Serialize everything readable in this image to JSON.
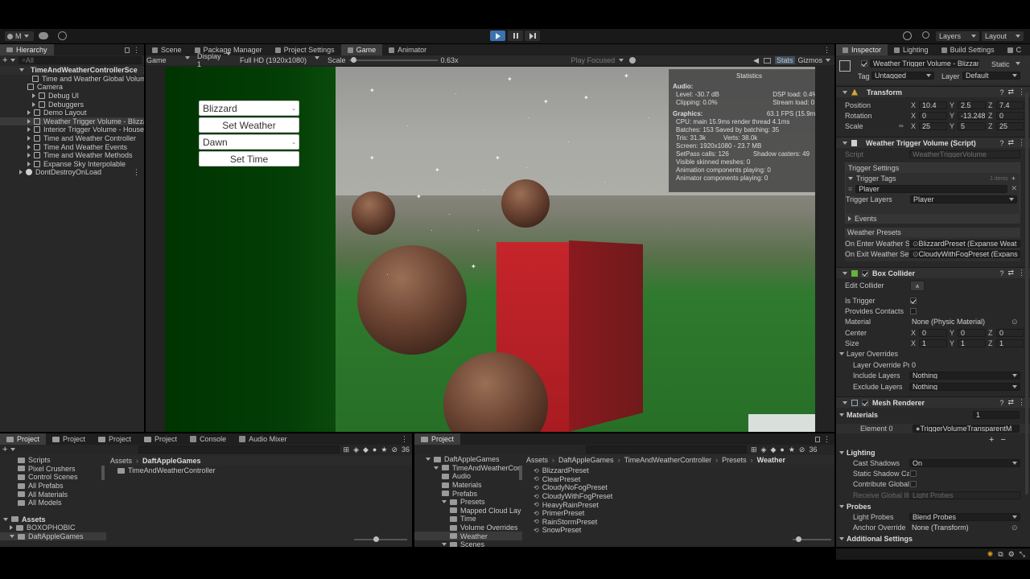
{
  "toolbar": {
    "account": "M",
    "layers": "Layers",
    "layout": "Layout"
  },
  "hierarchy": {
    "tab": "Hierarchy",
    "search_placeholder": "All",
    "root": "TimeAndWeatherControllerSce",
    "items": [
      "Time and Weather Global Volume",
      "Camera",
      "Debug UI",
      "Debuggers",
      "Demo Layout",
      "Weather Trigger Volume - Blizzar",
      "Interior Trigger Volume - House",
      "Time and Weather Controller",
      "Time And Weather Events",
      "Time and Weather Methods",
      "Expanse Sky Interpolable"
    ],
    "ddol": "DontDestroyOnLoad"
  },
  "center_tabs": [
    "Scene",
    "Package Manager",
    "Project Settings",
    "Game",
    "Animator"
  ],
  "game_bar": {
    "mode": "Game",
    "display": "Display 1",
    "resolution": "Full HD (1920x1080)",
    "scale_label": "Scale",
    "scale_value": "0.63x",
    "play_focused": "Play Focused",
    "stats": "Stats",
    "gizmos": "Gizmos"
  },
  "game_ui": {
    "weather_value": "Blizzard",
    "set_weather": "Set Weather",
    "time_value": "Dawn",
    "set_time": "Set Time"
  },
  "stats": {
    "title": "Statistics",
    "audio_hdr": "Audio:",
    "level": "Level: -30.7 dB",
    "clipping": "Clipping: 0.0%",
    "dsp": "DSP load: 0.4%",
    "stream": "Stream load: 0.0%",
    "graphics_hdr": "Graphics:",
    "fps": "63.1 FPS (15.9ms)",
    "cpu": "CPU: main 15.9ms  render thread 4.1ms",
    "batches": "Batches: 153    Saved by batching: 35",
    "tris": "Tris: 31.3k",
    "verts": "Verts: 38.0k",
    "screen": "Screen: 1920x1080 - 23.7 MB",
    "setpass": "SetPass calls: 126",
    "shadow": "Shadow casters: 49",
    "skinned": "Visible skinned meshes: 0",
    "anim": "Animation components playing: 0",
    "animator": "Animator components playing: 0"
  },
  "inspector_tabs": [
    "Inspector",
    "Lighting",
    "Build Settings",
    "C"
  ],
  "inspector": {
    "object_name": "Weather Trigger Volume - Blizzar",
    "static": "Static",
    "tag_label": "Tag",
    "tag_value": "Untagged",
    "layer_label": "Layer",
    "layer_value": "Default",
    "transform": {
      "title": "Transform",
      "position_label": "Position",
      "position": [
        "10.4",
        "2.5",
        "7.4"
      ],
      "rotation_label": "Rotation",
      "rotation": [
        "0",
        "-13.248",
        "0"
      ],
      "scale_label": "Scale",
      "scale": [
        "25",
        "5",
        "25"
      ]
    },
    "script_comp": {
      "title": "Weather Trigger Volume (Script)",
      "script_label": "Script",
      "script_value": "WeatherTriggerVolume",
      "trigger_settings": "Trigger Settings",
      "trigger_tags": "Trigger Tags",
      "items_count": "1 items",
      "tag_item": "Player",
      "trigger_layers_label": "Trigger Layers",
      "trigger_layers_value": "Player",
      "events": "Events",
      "weather_presets": "Weather Presets",
      "on_enter_label": "On Enter Weather Se",
      "on_enter_value": "BlizzardPreset (Expanse Weat",
      "on_exit_label": "On Exit Weather Sett",
      "on_exit_value": "CloudyWithFogPreset (Expans"
    },
    "box_collider": {
      "title": "Box Collider",
      "edit_collider": "Edit Collider",
      "is_trigger": "Is Trigger",
      "provides_contacts": "Provides Contacts",
      "material_label": "Material",
      "material_value": "None (Physic Material)",
      "center_label": "Center",
      "center": [
        "0",
        "0",
        "0"
      ],
      "size_label": "Size",
      "size": [
        "1",
        "1",
        "1"
      ],
      "layer_overrides": "Layer Overrides",
      "override_priority": "Layer Override Pric",
      "override_priority_value": "0",
      "include_layers": "Include Layers",
      "include_value": "Nothing",
      "exclude_layers": "Exclude Layers",
      "exclude_value": "Nothing"
    },
    "mesh_renderer": {
      "title": "Mesh Renderer",
      "materials": "Materials",
      "materials_count": "1",
      "element0_label": "Element 0",
      "element0_value": "TriggerVolumeTransparentM",
      "lighting": "Lighting",
      "cast_shadows": "Cast Shadows",
      "cast_shadows_value": "On",
      "static_shadow": "Static Shadow Cas",
      "contribute_gi": "Contribute Global I",
      "receive_gi": "Receive Global Illu",
      "receive_gi_value": "Light Probes",
      "probes": "Probes",
      "light_probes": "Light Probes",
      "light_probes_value": "Blend Probes",
      "anchor_override": "Anchor Override",
      "anchor_override_value": "None (Transform)",
      "additional": "Additional Settings"
    }
  },
  "bottom_left": {
    "tabs": [
      "Project",
      "Project",
      "Project",
      "Project",
      "Console",
      "Audio Mixer"
    ],
    "badge": "36",
    "tree": [
      "Scripts",
      "Pixel Crushers",
      "Control Scenes",
      "All Prefabs",
      "All Materials",
      "All Models"
    ],
    "assets_label": "Assets",
    "assets_children": [
      "BOXOPHOBIC",
      "DaftAppleGames"
    ],
    "breadcrumb": [
      "Assets",
      "DaftAppleGames"
    ],
    "folder_item": "TimeAndWeatherController"
  },
  "bottom_right": {
    "tab": "Project",
    "badge": "36",
    "tree": [
      {
        "label": "DaftAppleGames",
        "indent": 1
      },
      {
        "label": "TimeAndWeatherContr",
        "indent": 2
      },
      {
        "label": "Audio",
        "indent": 3
      },
      {
        "label": "Materials",
        "indent": 3
      },
      {
        "label": "Prefabs",
        "indent": 3
      },
      {
        "label": "Presets",
        "indent": 3
      },
      {
        "label": "Mapped Cloud Lay",
        "indent": 4
      },
      {
        "label": "Time",
        "indent": 4
      },
      {
        "label": "Volume Overrides",
        "indent": 4
      },
      {
        "label": "Weather",
        "indent": 4
      },
      {
        "label": "Scenes",
        "indent": 3
      }
    ],
    "breadcrumb": [
      "Assets",
      "DaftAppleGames",
      "TimeAndWeatherController",
      "Presets",
      "Weather"
    ],
    "files": [
      "BlizzardPreset",
      "ClearPreset",
      "CloudyNoFogPreset",
      "CloudyWithFogPreset",
      "HeavyRainPreset",
      "PrimerPreset",
      "RainStormPreset",
      "SnowPreset"
    ]
  },
  "colors": {
    "accent": "#3a72b0",
    "selection": "#2c5d87",
    "cube": "#c4262a",
    "green": "#2f7a2e"
  }
}
